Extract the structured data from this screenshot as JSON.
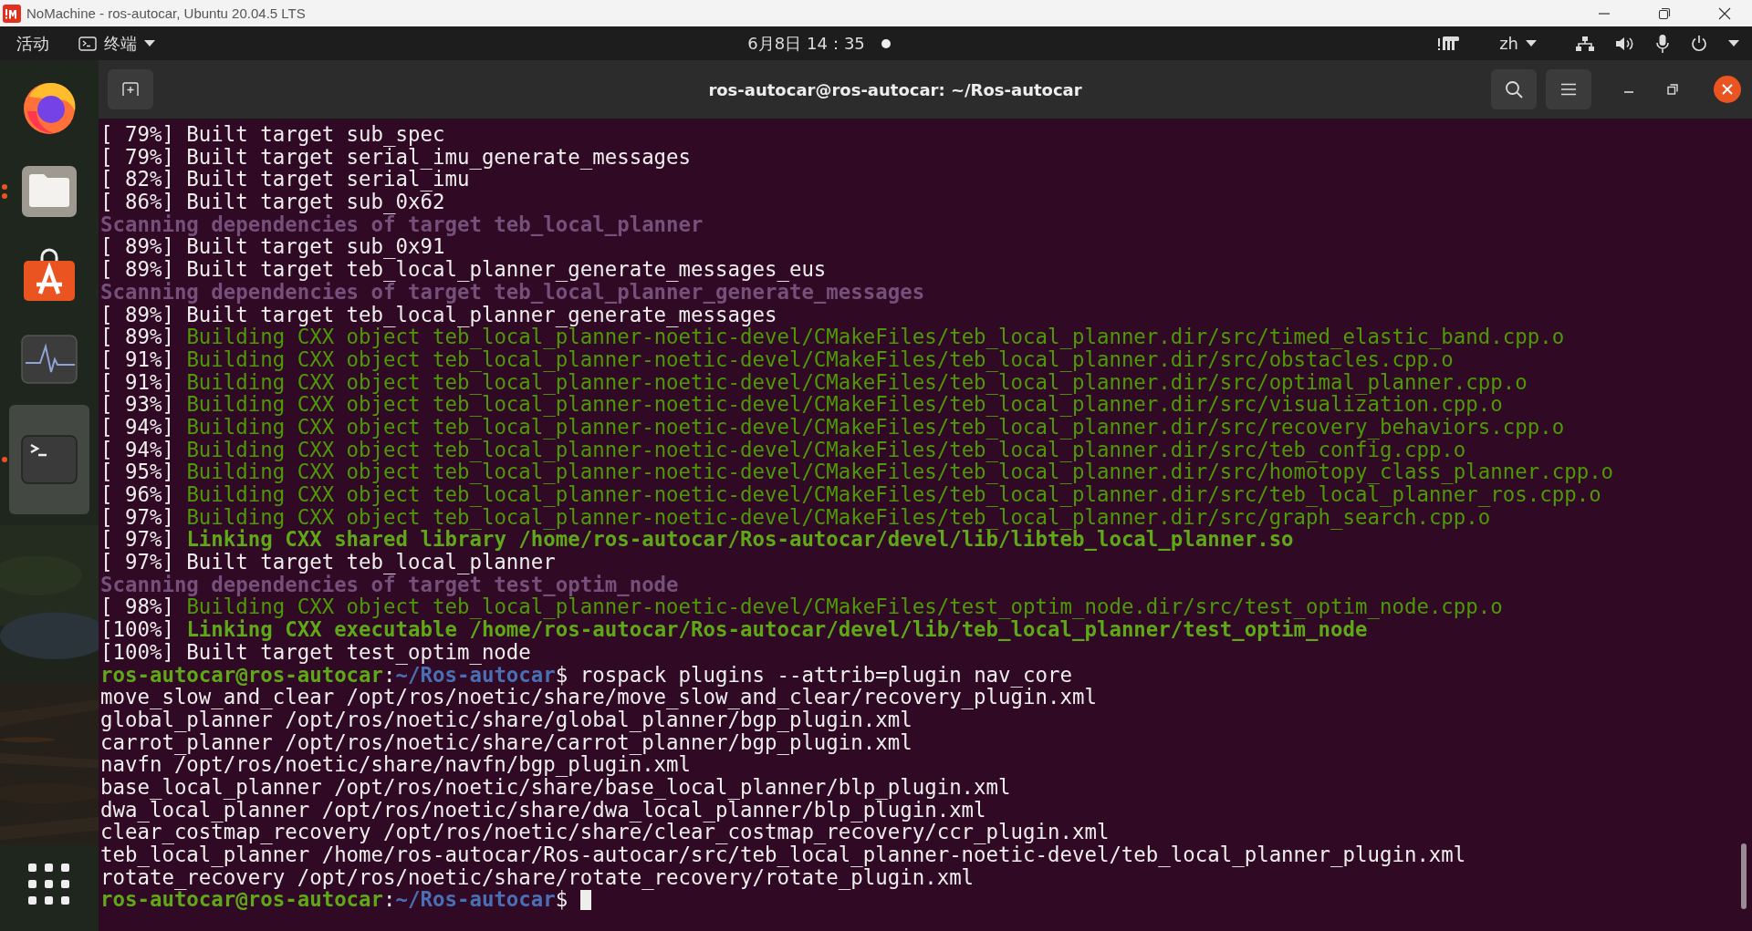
{
  "app_window": {
    "title": "NoMachine - ros-autocar, Ubuntu 20.04.5 LTS"
  },
  "top_bar": {
    "activities": "活动",
    "app_menu": "终端",
    "clock": "6月8日 14：35",
    "notification": true,
    "input_method": "zh"
  },
  "dock": {
    "items": [
      {
        "kind": "browser",
        "running": false,
        "selected": false
      },
      {
        "kind": "files",
        "running": true,
        "multiple_windows": true,
        "selected": false
      },
      {
        "kind": "store",
        "running": false,
        "selected": false
      },
      {
        "kind": "monitor",
        "running": false,
        "selected": false
      },
      {
        "kind": "terminal",
        "running": true,
        "selected": true
      }
    ]
  },
  "terminal": {
    "title": "ros-autocar@ros-autocar: ~/Ros-autocar",
    "lines": [
      {
        "segments": [
          {
            "text": "[ 79%] Built target sub_spec",
            "kind": "plain"
          }
        ]
      },
      {
        "segments": [
          {
            "text": "[ 79%] Built target serial_imu_generate_messages",
            "kind": "plain"
          }
        ]
      },
      {
        "segments": [
          {
            "text": "[ 82%] Built target serial_imu",
            "kind": "plain"
          }
        ]
      },
      {
        "segments": [
          {
            "text": "[ 86%] Built target sub_0x62",
            "kind": "plain"
          }
        ]
      },
      {
        "segments": [
          {
            "text": "Scanning dependencies of target teb_local_planner",
            "kind": "scan"
          }
        ]
      },
      {
        "segments": [
          {
            "text": "[ 89%] Built target sub_0x91",
            "kind": "plain"
          }
        ]
      },
      {
        "segments": [
          {
            "text": "[ 89%] Built target teb_local_planner_generate_messages_eus",
            "kind": "plain"
          }
        ]
      },
      {
        "segments": [
          {
            "text": "Scanning dependencies of target teb_local_planner_generate_messages",
            "kind": "scan"
          }
        ]
      },
      {
        "segments": [
          {
            "text": "[ 89%] Built target teb_local_planner_generate_messages",
            "kind": "plain"
          }
        ]
      },
      {
        "segments": [
          {
            "text": "[ 89%] ",
            "kind": "plain"
          },
          {
            "text": "Building CXX object teb_local_planner-noetic-devel/CMakeFiles/teb_local_planner.dir/src/timed_elastic_band.cpp.o",
            "kind": "build"
          }
        ]
      },
      {
        "segments": [
          {
            "text": "[ 91%] ",
            "kind": "plain"
          },
          {
            "text": "Building CXX object teb_local_planner-noetic-devel/CMakeFiles/teb_local_planner.dir/src/obstacles.cpp.o",
            "kind": "build"
          }
        ]
      },
      {
        "segments": [
          {
            "text": "[ 91%] ",
            "kind": "plain"
          },
          {
            "text": "Building CXX object teb_local_planner-noetic-devel/CMakeFiles/teb_local_planner.dir/src/optimal_planner.cpp.o",
            "kind": "build"
          }
        ]
      },
      {
        "segments": [
          {
            "text": "[ 93%] ",
            "kind": "plain"
          },
          {
            "text": "Building CXX object teb_local_planner-noetic-devel/CMakeFiles/teb_local_planner.dir/src/visualization.cpp.o",
            "kind": "build"
          }
        ]
      },
      {
        "segments": [
          {
            "text": "[ 94%] ",
            "kind": "plain"
          },
          {
            "text": "Building CXX object teb_local_planner-noetic-devel/CMakeFiles/teb_local_planner.dir/src/recovery_behaviors.cpp.o",
            "kind": "build"
          }
        ]
      },
      {
        "segments": [
          {
            "text": "[ 94%] ",
            "kind": "plain"
          },
          {
            "text": "Building CXX object teb_local_planner-noetic-devel/CMakeFiles/teb_local_planner.dir/src/teb_config.cpp.o",
            "kind": "build"
          }
        ]
      },
      {
        "segments": [
          {
            "text": "[ 95%] ",
            "kind": "plain"
          },
          {
            "text": "Building CXX object teb_local_planner-noetic-devel/CMakeFiles/teb_local_planner.dir/src/homotopy_class_planner.cpp.o",
            "kind": "build"
          }
        ]
      },
      {
        "segments": [
          {
            "text": "[ 96%] ",
            "kind": "plain"
          },
          {
            "text": "Building CXX object teb_local_planner-noetic-devel/CMakeFiles/teb_local_planner.dir/src/teb_local_planner_ros.cpp.o",
            "kind": "build"
          }
        ]
      },
      {
        "segments": [
          {
            "text": "[ 97%] ",
            "kind": "plain"
          },
          {
            "text": "Building CXX object teb_local_planner-noetic-devel/CMakeFiles/teb_local_planner.dir/src/graph_search.cpp.o",
            "kind": "build"
          }
        ]
      },
      {
        "segments": [
          {
            "text": "[ 97%] ",
            "kind": "plain"
          },
          {
            "text": "Linking CXX shared library /home/ros-autocar/Ros-autocar/devel/lib/libteb_local_planner.so",
            "kind": "link"
          }
        ]
      },
      {
        "segments": [
          {
            "text": "[ 97%] Built target teb_local_planner",
            "kind": "plain"
          }
        ]
      },
      {
        "segments": [
          {
            "text": "Scanning dependencies of target test_optim_node",
            "kind": "scan"
          }
        ]
      },
      {
        "segments": [
          {
            "text": "[ 98%] ",
            "kind": "plain"
          },
          {
            "text": "Building CXX object teb_local_planner-noetic-devel/CMakeFiles/test_optim_node.dir/src/test_optim_node.cpp.o",
            "kind": "build"
          }
        ]
      },
      {
        "segments": [
          {
            "text": "[100%] ",
            "kind": "plain"
          },
          {
            "text": "Linking CXX executable /home/ros-autocar/Ros-autocar/devel/lib/teb_local_planner/test_optim_node",
            "kind": "link"
          }
        ]
      },
      {
        "segments": [
          {
            "text": "[100%] Built target test_optim_node",
            "kind": "plain"
          }
        ]
      },
      {
        "segments": [
          {
            "text": "ros-autocar@ros-autocar",
            "kind": "user"
          },
          {
            "text": ":",
            "kind": "plain"
          },
          {
            "text": "~/Ros-autocar",
            "kind": "path"
          },
          {
            "text": "$ rospack plugins --attrib=plugin nav_core",
            "kind": "plain"
          }
        ]
      },
      {
        "segments": [
          {
            "text": "move_slow_and_clear /opt/ros/noetic/share/move_slow_and_clear/recovery_plugin.xml",
            "kind": "plain"
          }
        ]
      },
      {
        "segments": [
          {
            "text": "global_planner /opt/ros/noetic/share/global_planner/bgp_plugin.xml",
            "kind": "plain"
          }
        ]
      },
      {
        "segments": [
          {
            "text": "carrot_planner /opt/ros/noetic/share/carrot_planner/bgp_plugin.xml",
            "kind": "plain"
          }
        ]
      },
      {
        "segments": [
          {
            "text": "navfn /opt/ros/noetic/share/navfn/bgp_plugin.xml",
            "kind": "plain"
          }
        ]
      },
      {
        "segments": [
          {
            "text": "base_local_planner /opt/ros/noetic/share/base_local_planner/blp_plugin.xml",
            "kind": "plain"
          }
        ]
      },
      {
        "segments": [
          {
            "text": "dwa_local_planner /opt/ros/noetic/share/dwa_local_planner/blp_plugin.xml",
            "kind": "plain"
          }
        ]
      },
      {
        "segments": [
          {
            "text": "clear_costmap_recovery /opt/ros/noetic/share/clear_costmap_recovery/ccr_plugin.xml",
            "kind": "plain"
          }
        ]
      },
      {
        "segments": [
          {
            "text": "teb_local_planner /home/ros-autocar/Ros-autocar/src/teb_local_planner-noetic-devel/teb_local_planner_plugin.xml",
            "kind": "plain"
          }
        ]
      },
      {
        "segments": [
          {
            "text": "rotate_recovery /opt/ros/noetic/share/rotate_recovery/rotate_plugin.xml",
            "kind": "plain"
          }
        ]
      },
      {
        "segments": [
          {
            "text": "ros-autocar@ros-autocar",
            "kind": "user"
          },
          {
            "text": ":",
            "kind": "plain"
          },
          {
            "text": "~/Ros-autocar",
            "kind": "path"
          },
          {
            "text": "$ ",
            "kind": "plain"
          }
        ],
        "cursor": true
      }
    ]
  }
}
